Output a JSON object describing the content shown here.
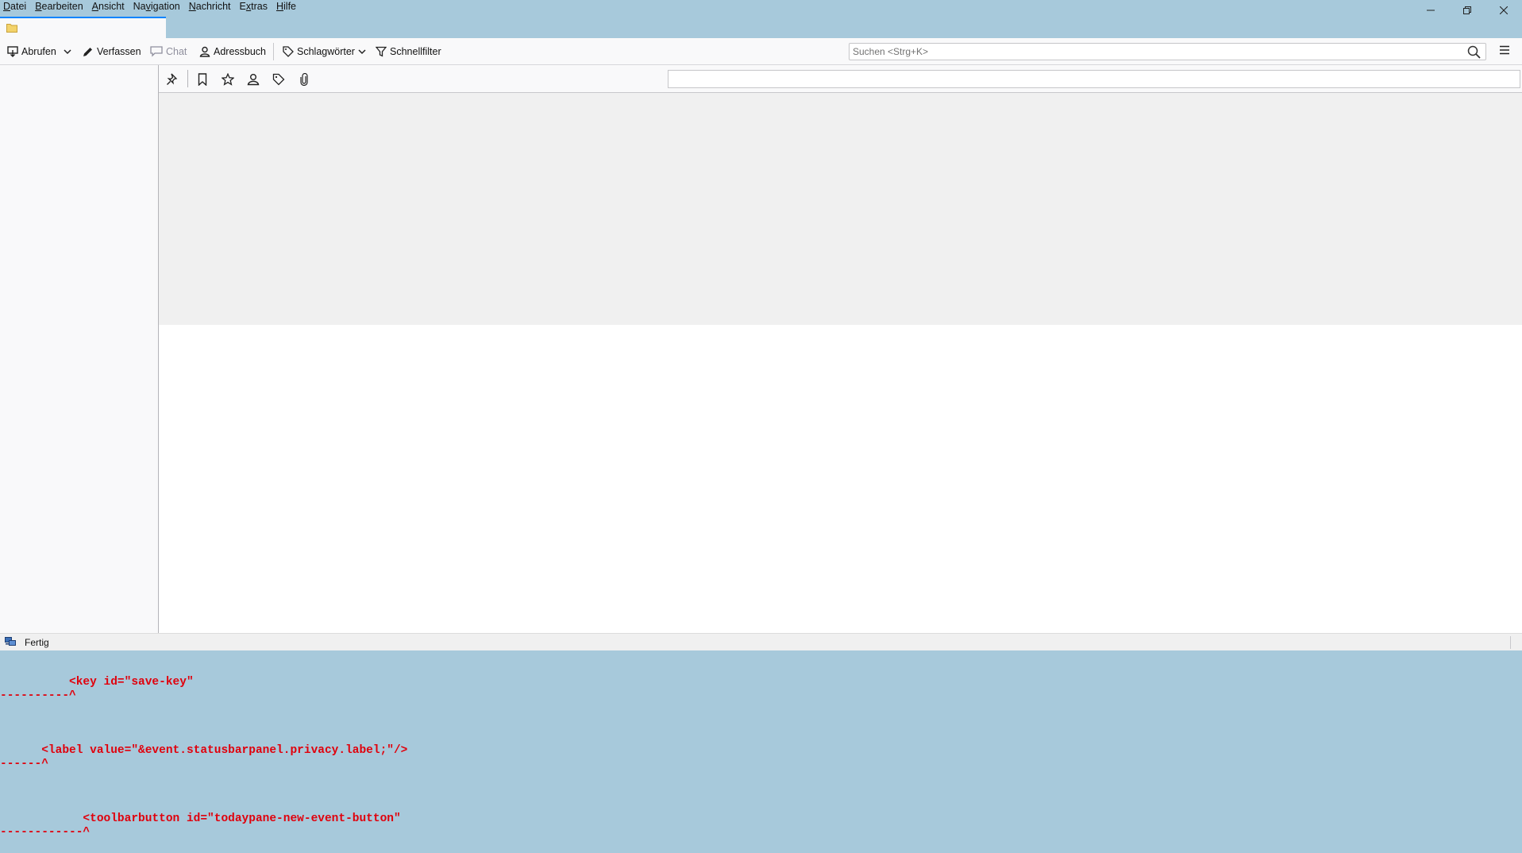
{
  "menubar": {
    "items": [
      {
        "pre": "",
        "acc": "D",
        "post": "atei"
      },
      {
        "pre": "",
        "acc": "B",
        "post": "earbeiten"
      },
      {
        "pre": "",
        "acc": "A",
        "post": "nsicht"
      },
      {
        "pre": "Na",
        "acc": "v",
        "post": "igation"
      },
      {
        "pre": "",
        "acc": "N",
        "post": "achricht"
      },
      {
        "pre": "E",
        "acc": "x",
        "post": "tras"
      },
      {
        "pre": "",
        "acc": "H",
        "post": "ilfe"
      }
    ]
  },
  "toolbar": {
    "get_messages": "Abrufen",
    "compose": "Verfassen",
    "chat": "Chat",
    "address_book": "Adressbuch",
    "tags": "Schlagwörter",
    "quick_filter": "Schnellfilter"
  },
  "search": {
    "placeholder": "Suchen <Strg+K>",
    "value": ""
  },
  "quickfilter": {
    "input_value": ""
  },
  "statusbar": {
    "text": "Fertig"
  },
  "errors": [
    {
      "code": "          <key id=\"save-key\"",
      "marker": "----------^"
    },
    {
      "code": "      <label value=\"&event.statusbarpanel.privacy.label;\"/>",
      "marker": "------^"
    },
    {
      "code": "            <toolbarbutton id=\"todaypane-new-event-button\"",
      "marker": "------------^"
    }
  ],
  "colors": {
    "titlebar": "#a7c9db",
    "accent": "#0a84ff",
    "error_text": "#e0000c"
  }
}
